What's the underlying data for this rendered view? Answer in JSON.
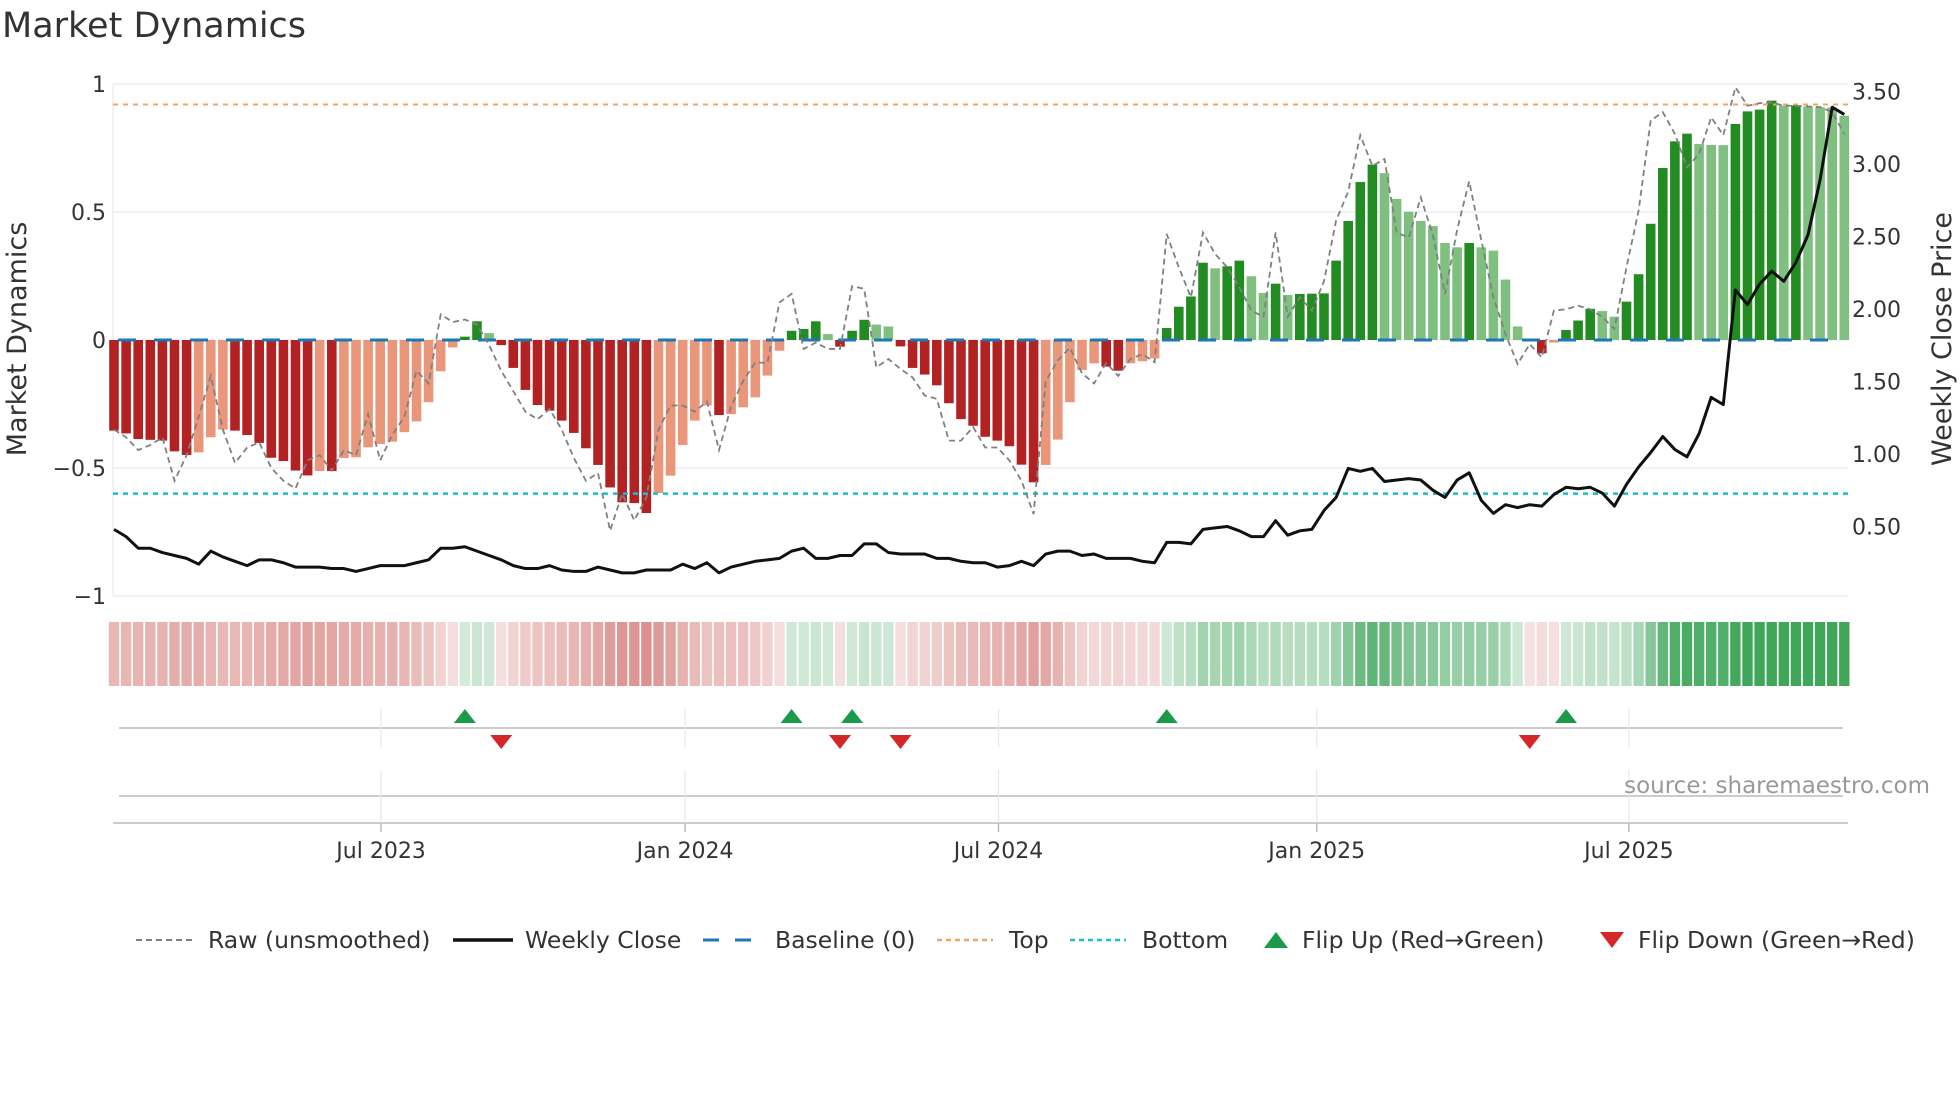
{
  "title": "Market Dynamics",
  "source": "source: sharemaestro.com",
  "colors": {
    "dark_red": "#b22222",
    "light_red": "#e9967a",
    "dark_green": "#228b22",
    "light_green": "#7fbf7f",
    "baseline": "#1f77b4",
    "top": "#f4a460",
    "bottom": "#17becf",
    "raw": "#808080",
    "close": "#111111",
    "flip_up": "#1a9a4a",
    "flip_down": "#d62728",
    "strip_red": "#d47a76",
    "strip_green": "#3fa65a"
  },
  "legend": [
    {
      "key": "raw",
      "label": "Raw (unsmoothed)"
    },
    {
      "key": "close",
      "label": "Weekly Close"
    },
    {
      "key": "baseline",
      "label": "Baseline (0)"
    },
    {
      "key": "top",
      "label": "Top"
    },
    {
      "key": "bottom",
      "label": "Bottom"
    },
    {
      "key": "flip_up",
      "label": "Flip Up (Red→Green)"
    },
    {
      "key": "flip_down",
      "label": "Flip Down (Green→Red)"
    }
  ],
  "chart_data": {
    "type": "bar",
    "title": "Market Dynamics",
    "ylabel": "Market Dynamics",
    "y2label": "Weekly Close Price",
    "ylim": [
      -1,
      1
    ],
    "y2lim": [
      0,
      3.55
    ],
    "yticks": [
      {
        "v": 1,
        "label": "1"
      },
      {
        "v": 0.5,
        "label": "0.5"
      },
      {
        "v": 0,
        "label": "0"
      },
      {
        "v": -0.5,
        "label": "−0.5"
      },
      {
        "v": -1,
        "label": "−1"
      }
    ],
    "y2ticks": [
      {
        "v": 3.5,
        "label": "3.50"
      },
      {
        "v": 3.0,
        "label": "3.00"
      },
      {
        "v": 2.5,
        "label": "2.50"
      },
      {
        "v": 2.0,
        "label": "2.00"
      },
      {
        "v": 1.5,
        "label": "1.50"
      },
      {
        "v": 1.0,
        "label": "1.00"
      },
      {
        "v": 0.5,
        "label": "0.50"
      }
    ],
    "xticks": [
      {
        "week": 23.07,
        "label": "Jul 2023"
      },
      {
        "week": 48.2,
        "label": "Jan 2024"
      },
      {
        "week": 74.1,
        "label": "Jul 2024"
      },
      {
        "week": 100.4,
        "label": "Jan 2025"
      },
      {
        "week": 126.2,
        "label": "Jul 2025"
      }
    ],
    "grid": true,
    "legend_position": "bottom",
    "top_level": 0.92,
    "bottom_level": -0.6,
    "baseline": 0,
    "weeks": 144,
    "dynamics": [
      -0.354,
      -0.365,
      -0.387,
      -0.39,
      -0.393,
      -0.435,
      -0.449,
      -0.439,
      -0.38,
      -0.35,
      -0.354,
      -0.371,
      -0.402,
      -0.46,
      -0.473,
      -0.51,
      -0.529,
      -0.512,
      -0.512,
      -0.461,
      -0.458,
      -0.419,
      -0.406,
      -0.397,
      -0.36,
      -0.318,
      -0.243,
      -0.122,
      -0.029,
      0.013,
      0.073,
      0.027,
      -0.02,
      -0.109,
      -0.195,
      -0.254,
      -0.276,
      -0.315,
      -0.363,
      -0.423,
      -0.488,
      -0.576,
      -0.634,
      -0.637,
      -0.676,
      -0.598,
      -0.53,
      -0.41,
      -0.315,
      -0.256,
      -0.293,
      -0.29,
      -0.263,
      -0.224,
      -0.139,
      -0.042,
      0.036,
      0.043,
      0.073,
      0.023,
      -0.026,
      0.036,
      0.079,
      0.06,
      0.053,
      -0.025,
      -0.109,
      -0.135,
      -0.177,
      -0.247,
      -0.309,
      -0.335,
      -0.378,
      -0.393,
      -0.415,
      -0.487,
      -0.556,
      -0.488,
      -0.389,
      -0.243,
      -0.117,
      -0.091,
      -0.104,
      -0.12,
      -0.091,
      -0.083,
      -0.072,
      0.047,
      0.13,
      0.17,
      0.302,
      0.28,
      0.288,
      0.31,
      0.249,
      0.184,
      0.22,
      0.176,
      0.18,
      0.181,
      0.182,
      0.31,
      0.465,
      0.617,
      0.685,
      0.652,
      0.551,
      0.501,
      0.465,
      0.445,
      0.379,
      0.362,
      0.379,
      0.362,
      0.349,
      0.236,
      0.053,
      -0.005,
      -0.052,
      -0.01,
      0.039,
      0.076,
      0.122,
      0.113,
      0.091,
      0.15,
      0.257,
      0.454,
      0.672,
      0.776,
      0.806,
      0.766,
      0.762,
      0.761,
      0.844,
      0.893,
      0.9,
      0.935,
      0.915,
      0.916,
      0.912,
      0.909,
      0.908,
      0.876
    ],
    "raw": [
      -0.35,
      -0.38,
      -0.43,
      -0.41,
      -0.38,
      -0.55,
      -0.45,
      -0.3,
      -0.14,
      -0.35,
      -0.48,
      -0.42,
      -0.4,
      -0.5,
      -0.55,
      -0.58,
      -0.47,
      -0.45,
      -0.51,
      -0.43,
      -0.45,
      -0.29,
      -0.47,
      -0.37,
      -0.3,
      -0.12,
      -0.17,
      0.1,
      0.07,
      0.08,
      0.06,
      -0.02,
      -0.12,
      -0.2,
      -0.28,
      -0.31,
      -0.27,
      -0.35,
      -0.46,
      -0.55,
      -0.52,
      -0.745,
      -0.6,
      -0.705,
      -0.615,
      -0.35,
      -0.256,
      -0.256,
      -0.28,
      -0.24,
      -0.43,
      -0.26,
      -0.16,
      -0.087,
      -0.09,
      0.147,
      0.18,
      -0.035,
      -0.01,
      -0.035,
      -0.035,
      0.21,
      0.2,
      -0.107,
      -0.074,
      -0.113,
      -0.146,
      -0.217,
      -0.23,
      -0.393,
      -0.393,
      -0.34,
      -0.42,
      -0.42,
      -0.47,
      -0.55,
      -0.68,
      -0.16,
      -0.08,
      -0.03,
      -0.13,
      -0.17,
      -0.09,
      -0.14,
      -0.074,
      -0.055,
      -0.087,
      0.414,
      0.284,
      0.167,
      0.42,
      0.336,
      0.284,
      0.206,
      0.115,
      0.09,
      0.42,
      0.09,
      0.167,
      0.115,
      0.23,
      0.466,
      0.58,
      0.8,
      0.68,
      0.707,
      0.42,
      0.4,
      0.557,
      0.41,
      0.18,
      0.43,
      0.62,
      0.39,
      0.167,
      0.023,
      -0.094,
      -0.016,
      -0.068,
      0.115,
      0.12,
      0.134,
      0.12,
      0.09,
      0.043,
      0.284,
      0.505,
      0.857,
      0.89,
      0.805,
      0.674,
      0.727,
      0.87,
      0.8,
      0.987,
      0.915,
      0.925,
      0.928,
      0.915,
      0.915,
      0.912,
      0.91,
      0.89,
      0.805
    ],
    "weekly_close": [
      0.48,
      0.43,
      0.35,
      0.35,
      0.32,
      0.3,
      0.28,
      0.24,
      0.33,
      0.29,
      0.26,
      0.23,
      0.27,
      0.27,
      0.25,
      0.22,
      0.22,
      0.22,
      0.21,
      0.21,
      0.19,
      0.21,
      0.23,
      0.23,
      0.23,
      0.25,
      0.27,
      0.35,
      0.35,
      0.36,
      0.33,
      0.3,
      0.27,
      0.23,
      0.21,
      0.21,
      0.23,
      0.2,
      0.19,
      0.19,
      0.22,
      0.2,
      0.18,
      0.18,
      0.2,
      0.2,
      0.2,
      0.24,
      0.21,
      0.25,
      0.18,
      0.22,
      0.24,
      0.26,
      0.27,
      0.28,
      0.33,
      0.35,
      0.28,
      0.28,
      0.3,
      0.3,
      0.38,
      0.38,
      0.32,
      0.31,
      0.31,
      0.31,
      0.28,
      0.28,
      0.26,
      0.25,
      0.25,
      0.22,
      0.23,
      0.26,
      0.23,
      0.31,
      0.33,
      0.33,
      0.3,
      0.31,
      0.28,
      0.28,
      0.28,
      0.26,
      0.25,
      0.39,
      0.39,
      0.38,
      0.48,
      0.49,
      0.5,
      0.47,
      0.43,
      0.43,
      0.54,
      0.44,
      0.47,
      0.48,
      0.61,
      0.7,
      0.9,
      0.88,
      0.9,
      0.81,
      0.82,
      0.83,
      0.82,
      0.75,
      0.7,
      0.82,
      0.87,
      0.68,
      0.59,
      0.65,
      0.63,
      0.65,
      0.64,
      0.72,
      0.77,
      0.76,
      0.77,
      0.73,
      0.64,
      0.79,
      0.91,
      1.01,
      1.12,
      1.03,
      0.98,
      1.14,
      1.39,
      1.34,
      2.13,
      2.03,
      2.17,
      2.26,
      2.19,
      2.32,
      2.51,
      2.89,
      3.39,
      3.34
    ],
    "flip_up_weeks": [
      30,
      57,
      62,
      88,
      121
    ],
    "flip_down_weeks": [
      33,
      61,
      66,
      118
    ]
  }
}
